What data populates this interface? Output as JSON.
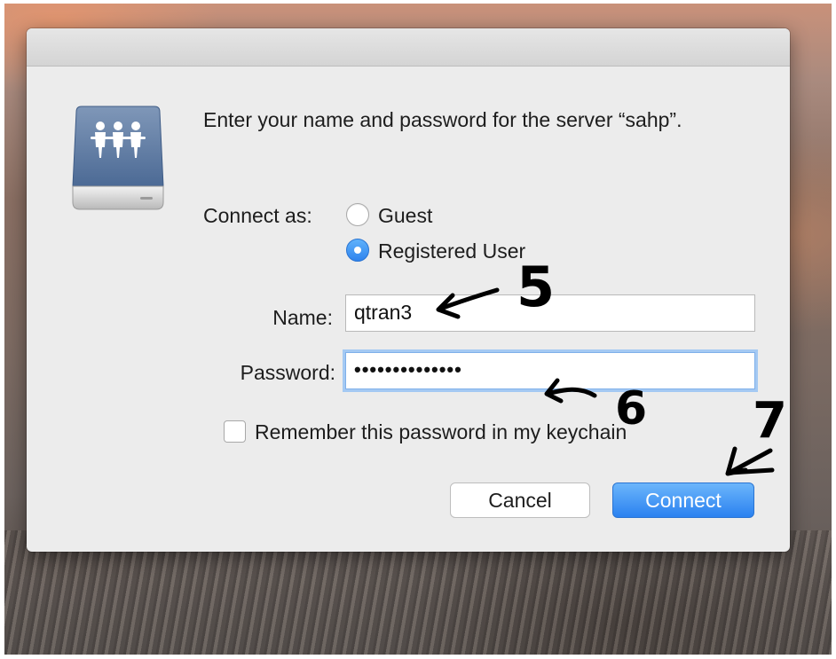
{
  "dialog": {
    "prompt": "Enter your name and password for the server “sahp”.",
    "connect_as_label": "Connect as:",
    "options": [
      {
        "label": "Guest",
        "selected": false
      },
      {
        "label": "Registered User",
        "selected": true
      }
    ],
    "name_label": "Name:",
    "name_value": "qtran3",
    "password_label": "Password:",
    "password_value": "••••••••••••••",
    "remember_label": "Remember this password in my keychain",
    "remember_checked": false,
    "cancel_label": "Cancel",
    "connect_label": "Connect",
    "accent_color": "#2f83ee",
    "icon": "shared-server-icon"
  },
  "annotations": [
    "5",
    "6",
    "7"
  ]
}
